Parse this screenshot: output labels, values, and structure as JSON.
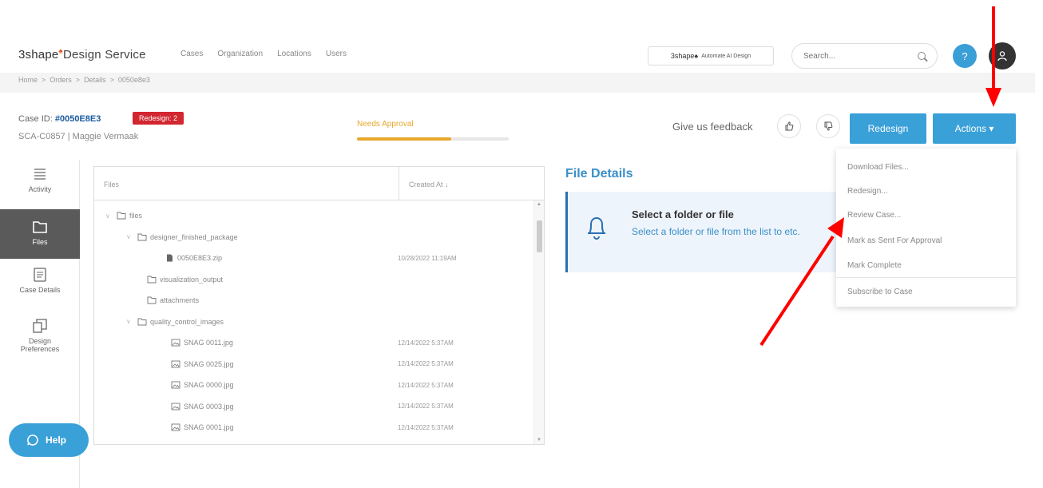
{
  "header": {
    "brand": "3shape",
    "brand_mark": "♠",
    "brand_service": "Design Service",
    "nav": [
      "Cases",
      "Organization",
      "Locations",
      "Users"
    ],
    "ai_logo_brand": "3shape♠",
    "ai_logo_text": "Automate AI Design",
    "search_placeholder": "Search...",
    "help_label": "?",
    "avatar_icon": "user-icon"
  },
  "breadcrumb": [
    "Home",
    ">",
    "Orders",
    ">",
    "Details",
    ">",
    "0050e8e3"
  ],
  "case": {
    "id_label": "Case ID:",
    "id_value": "#0050E8E3",
    "badge": "Redesign: 2",
    "subtitle": "SCA-C0857 | Maggie Vermaak",
    "status": "Needs Approval",
    "status_progress": 0.62,
    "status_color": "#e8a72c",
    "feedback_label": "Give us feedback",
    "thumbs_up_icon": "thumbs-up-icon",
    "thumbs_down_icon": "thumbs-down-icon",
    "redesign_button": "Redesign",
    "actions_button": "Actions ▾"
  },
  "sidebar": {
    "items": [
      {
        "label": "Activity",
        "icon": "list-icon"
      },
      {
        "label": "Files",
        "icon": "folder-icon"
      },
      {
        "label": "Case Details",
        "icon": "document-icon"
      },
      {
        "label": "Design Preferences",
        "icon": "copy-icon"
      }
    ],
    "help_button": "Help"
  },
  "files": {
    "col_files": "Files",
    "col_created": "Created At ↓",
    "rows": [
      {
        "name": "files",
        "date": "",
        "type": "folder",
        "caret": "∨"
      },
      {
        "name": "designer_finished_package",
        "date": "",
        "type": "folder",
        "caret": "∨"
      },
      {
        "name": "0050E8E3.zip",
        "date": "10/28/2022 11:19AM",
        "type": "file",
        "caret": ""
      },
      {
        "name": "visualization_output",
        "date": "",
        "type": "folder",
        "caret": ""
      },
      {
        "name": "attachments",
        "date": "",
        "type": "folder",
        "caret": ""
      },
      {
        "name": "quality_control_images",
        "date": "",
        "type": "folder",
        "caret": "∨"
      },
      {
        "name": "SNAG 0011.jpg",
        "date": "12/14/2022 5:37AM",
        "type": "image",
        "caret": ""
      },
      {
        "name": "SNAG 0025.jpg",
        "date": "12/14/2022 5:37AM",
        "type": "image",
        "caret": ""
      },
      {
        "name": "SNAG 0000.jpg",
        "date": "12/14/2022 5:37AM",
        "type": "image",
        "caret": ""
      },
      {
        "name": "SNAG 0003.jpg",
        "date": "12/14/2022 5:37AM",
        "type": "image",
        "caret": ""
      },
      {
        "name": "SNAG 0001.jpg",
        "date": "12/14/2022 5:37AM",
        "type": "image",
        "caret": ""
      }
    ]
  },
  "details": {
    "title": "File Details",
    "card_title": "Select a folder or file",
    "card_text": "Select a folder or file from the list to etc.",
    "card_icon": "bell-icon"
  },
  "actions_menu": [
    "Download Files...",
    "Redesign...",
    "Review Case...",
    "Mark as Sent For Approval",
    "Mark Complete",
    "Subscribe to Case"
  ],
  "colors": {
    "accent": "#3aa0d8",
    "badge_red": "#d22630",
    "link_blue": "#1a5aa0",
    "annotation_red": "#ff0000"
  }
}
